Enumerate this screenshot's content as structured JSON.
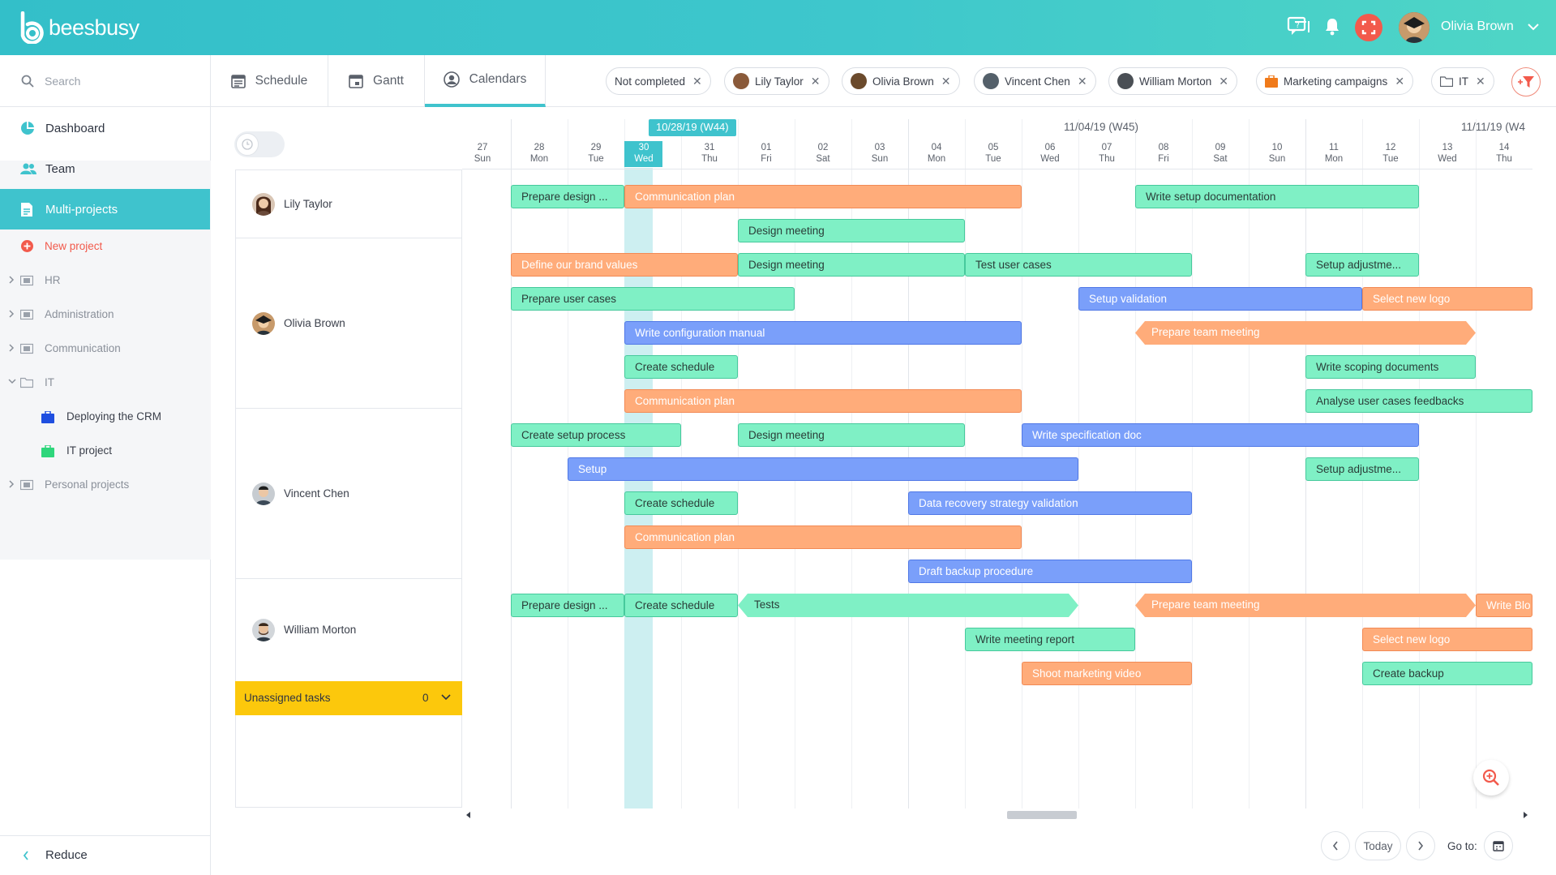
{
  "app": {
    "logo_text": "beesbusy",
    "user_name": "Olivia Brown"
  },
  "sidebar": {
    "search_placeholder": "Search",
    "nav": [
      {
        "label": "Dashboard",
        "icon": "dashboard-icon"
      },
      {
        "label": "Team",
        "icon": "team-icon"
      },
      {
        "label": "Multi-projects",
        "icon": "multi-projects-icon",
        "active": true
      }
    ],
    "new_project": "New project",
    "tree": [
      {
        "label": "HR",
        "letter": "H"
      },
      {
        "label": "Administration",
        "letter": "A"
      },
      {
        "label": "Communication",
        "letter": "C"
      },
      {
        "label": "IT",
        "letter": "",
        "expanded": true
      },
      {
        "label": "Deploying the CRM",
        "color": "#1f4fe0"
      },
      {
        "label": "IT project",
        "color": "#2fd67c"
      },
      {
        "label": "Personal projects",
        "letter": "P"
      }
    ],
    "reduce": "Reduce"
  },
  "tabs": [
    {
      "label": "Schedule",
      "icon": "schedule-icon"
    },
    {
      "label": "Gantt",
      "icon": "gantt-icon"
    },
    {
      "label": "Calendars",
      "icon": "calendars-icon",
      "active": true
    }
  ],
  "filters": [
    {
      "label": "Not completed",
      "type": "text"
    },
    {
      "label": "Lily Taylor",
      "type": "person"
    },
    {
      "label": "Olivia Brown",
      "type": "person"
    },
    {
      "label": "Vincent Chen",
      "type": "person"
    },
    {
      "label": "William Morton",
      "type": "person"
    },
    {
      "label": "Marketing campaigns",
      "type": "project"
    },
    {
      "label": "IT",
      "type": "folder"
    }
  ],
  "people": [
    {
      "name": "Lily Taylor"
    },
    {
      "name": "Olivia Brown"
    },
    {
      "name": "Vincent Chen"
    },
    {
      "name": "William Morton"
    }
  ],
  "unassigned": {
    "label": "Unassigned tasks",
    "count": "0"
  },
  "timeline": {
    "weeks": [
      "10/28/19 (W44)",
      "11/04/19 (W45)",
      "11/11/19 (W4"
    ],
    "days": [
      {
        "num": "27",
        "name": "Sun"
      },
      {
        "num": "28",
        "name": "Mon"
      },
      {
        "num": "29",
        "name": "Tue"
      },
      {
        "num": "30",
        "name": "Wed",
        "today": true
      },
      {
        "num": "31",
        "name": "Thu"
      },
      {
        "num": "01",
        "name": "Fri"
      },
      {
        "num": "02",
        "name": "Sat"
      },
      {
        "num": "03",
        "name": "Sun"
      },
      {
        "num": "04",
        "name": "Mon"
      },
      {
        "num": "05",
        "name": "Tue"
      },
      {
        "num": "06",
        "name": "Wed"
      },
      {
        "num": "07",
        "name": "Thu"
      },
      {
        "num": "08",
        "name": "Fri"
      },
      {
        "num": "09",
        "name": "Sat"
      },
      {
        "num": "10",
        "name": "Sun"
      },
      {
        "num": "11",
        "name": "Mon"
      },
      {
        "num": "12",
        "name": "Tue"
      },
      {
        "num": "13",
        "name": "Wed"
      },
      {
        "num": "14",
        "name": "Thu"
      }
    ]
  },
  "tasks": [
    {
      "label": "Prepare design ...",
      "color": "green",
      "row": 0,
      "start": 1,
      "end": 3
    },
    {
      "label": "Communication plan",
      "color": "orange",
      "row": 0,
      "start": 3,
      "end": 10
    },
    {
      "label": "Write setup documentation",
      "color": "green",
      "row": 0,
      "start": 12,
      "end": 17
    },
    {
      "label": "Design meeting",
      "color": "green",
      "row": 1,
      "start": 5,
      "end": 9
    },
    {
      "label": "Define our brand values",
      "color": "orange",
      "row": 2,
      "start": 1,
      "end": 5
    },
    {
      "label": "Design meeting",
      "color": "green",
      "row": 2,
      "start": 5,
      "end": 9
    },
    {
      "label": "Test user cases",
      "color": "green",
      "row": 2,
      "start": 9,
      "end": 13
    },
    {
      "label": "Setup adjustme...",
      "color": "green",
      "row": 2,
      "start": 15,
      "end": 17
    },
    {
      "label": "Prepare user cases",
      "color": "green",
      "row": 3,
      "start": 1,
      "end": 6
    },
    {
      "label": "Setup validation",
      "color": "blue",
      "row": 3,
      "start": 11,
      "end": 16
    },
    {
      "label": "Select new logo",
      "color": "orange",
      "row": 3,
      "start": 16,
      "end": 19
    },
    {
      "label": "Write configuration manual",
      "color": "blue",
      "row": 4,
      "start": 3,
      "end": 10
    },
    {
      "label": "Prepare team meeting",
      "color": "orange",
      "row": 4,
      "start": 12,
      "end": 18,
      "shape": "arrowlr"
    },
    {
      "label": "Create schedule",
      "color": "green",
      "row": 5,
      "start": 3,
      "end": 5
    },
    {
      "label": "Write scoping documents",
      "color": "green",
      "row": 5,
      "start": 15,
      "end": 18
    },
    {
      "label": "Communication plan",
      "color": "orange",
      "row": 6,
      "start": 3,
      "end": 10
    },
    {
      "label": "Analyse user cases feedbacks",
      "color": "green",
      "row": 6,
      "start": 15,
      "end": 19
    },
    {
      "label": "Create setup process",
      "color": "green",
      "row": 7,
      "start": 1,
      "end": 4
    },
    {
      "label": "Design meeting",
      "color": "green",
      "row": 7,
      "start": 5,
      "end": 9
    },
    {
      "label": "Write specification doc",
      "color": "blue",
      "row": 7,
      "start": 10,
      "end": 17
    },
    {
      "label": "Setup",
      "color": "blue",
      "row": 8,
      "start": 2,
      "end": 11
    },
    {
      "label": "Setup adjustme...",
      "color": "green",
      "row": 8,
      "start": 15,
      "end": 17
    },
    {
      "label": "Create schedule",
      "color": "green",
      "row": 9,
      "start": 3,
      "end": 5
    },
    {
      "label": "Data recovery strategy validation",
      "color": "blue",
      "row": 9,
      "start": 8,
      "end": 13
    },
    {
      "label": "Communication plan",
      "color": "orange",
      "row": 10,
      "start": 3,
      "end": 10
    },
    {
      "label": "Draft backup procedure",
      "color": "blue",
      "row": 11,
      "start": 8,
      "end": 13
    },
    {
      "label": "Prepare design ...",
      "color": "green",
      "row": 12,
      "start": 1,
      "end": 3
    },
    {
      "label": "Create schedule",
      "color": "green",
      "row": 12,
      "start": 3,
      "end": 5
    },
    {
      "label": "Tests",
      "color": "green",
      "row": 12,
      "start": 5,
      "end": 11,
      "shape": "arrowlr"
    },
    {
      "label": "Prepare team meeting",
      "color": "orange",
      "row": 12,
      "start": 12,
      "end": 18,
      "shape": "arrowlr"
    },
    {
      "label": "Write Blo",
      "color": "orange",
      "row": 12,
      "start": 18,
      "end": 19
    },
    {
      "label": "Write meeting report",
      "color": "green",
      "row": 13,
      "start": 9,
      "end": 12
    },
    {
      "label": "Select new logo",
      "color": "orange",
      "row": 13,
      "start": 16,
      "end": 19
    },
    {
      "label": "Shoot marketing video",
      "color": "orange",
      "row": 14,
      "start": 10,
      "end": 13
    },
    {
      "label": "Create backup",
      "color": "green",
      "row": 14,
      "start": 16,
      "end": 19
    }
  ],
  "footer": {
    "today": "Today",
    "goto": "Go to:"
  },
  "colors": {
    "accent": "#3fc3cd",
    "green": "#7ff0c5",
    "orange": "#ffac7a",
    "blue": "#7a9ffa",
    "unassigned": "#fcc80c"
  }
}
